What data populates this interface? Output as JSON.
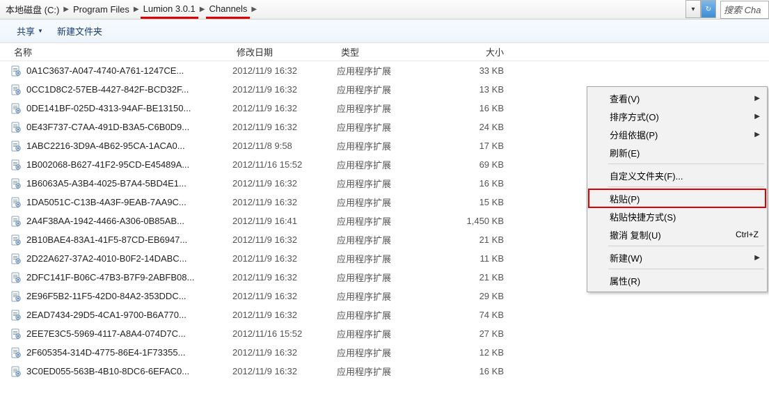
{
  "breadcrumb": {
    "items": [
      {
        "label": "本地磁盘 (C:)",
        "underline": false
      },
      {
        "label": "Program Files",
        "underline": false
      },
      {
        "label": "Lumion 3.0.1",
        "underline": true
      },
      {
        "label": "Channels",
        "underline": true
      }
    ]
  },
  "search": {
    "placeholder": "搜索 Cha"
  },
  "toolbar": {
    "share": "共享",
    "newfolder": "新建文件夹"
  },
  "columns": {
    "name": "名称",
    "date": "修改日期",
    "type": "类型",
    "size": "大小"
  },
  "file_type_label": "应用程序扩展",
  "files": [
    {
      "name": "0A1C3637-A047-4740-A761-1247CE...",
      "date": "2012/11/9 16:32",
      "size": "33 KB"
    },
    {
      "name": "0CC1D8C2-57EB-4427-842F-BCD32F...",
      "date": "2012/11/9 16:32",
      "size": "13 KB"
    },
    {
      "name": "0DE141BF-025D-4313-94AF-BE13150...",
      "date": "2012/11/9 16:32",
      "size": "16 KB"
    },
    {
      "name": "0E43F737-C7AA-491D-B3A5-C6B0D9...",
      "date": "2012/11/9 16:32",
      "size": "24 KB"
    },
    {
      "name": "1ABC2216-3D9A-4B62-95CA-1ACA0...",
      "date": "2012/11/8 9:58",
      "size": "17 KB"
    },
    {
      "name": "1B002068-B627-41F2-95CD-E45489A...",
      "date": "2012/11/16 15:52",
      "size": "69 KB"
    },
    {
      "name": "1B6063A5-A3B4-4025-B7A4-5BD4E1...",
      "date": "2012/11/9 16:32",
      "size": "16 KB"
    },
    {
      "name": "1DA5051C-C13B-4A3F-9EAB-7AA9C...",
      "date": "2012/11/9 16:32",
      "size": "15 KB"
    },
    {
      "name": "2A4F38AA-1942-4466-A306-0B85AB...",
      "date": "2012/11/9 16:41",
      "size": "1,450 KB"
    },
    {
      "name": "2B10BAE4-83A1-41F5-87CD-EB6947...",
      "date": "2012/11/9 16:32",
      "size": "21 KB"
    },
    {
      "name": "2D22A627-37A2-4010-B0F2-14DABC...",
      "date": "2012/11/9 16:32",
      "size": "11 KB"
    },
    {
      "name": "2DFC141F-B06C-47B3-B7F9-2ABFB08...",
      "date": "2012/11/9 16:32",
      "size": "21 KB"
    },
    {
      "name": "2E96F5B2-11F5-42D0-84A2-353DDC...",
      "date": "2012/11/9 16:32",
      "size": "29 KB"
    },
    {
      "name": "2EAD7434-29D5-4CA1-9700-B6A770...",
      "date": "2012/11/9 16:32",
      "size": "74 KB"
    },
    {
      "name": "2EE7E3C5-5969-4117-A8A4-074D7C...",
      "date": "2012/11/16 15:52",
      "size": "27 KB"
    },
    {
      "name": "2F605354-314D-4775-86E4-1F73355...",
      "date": "2012/11/9 16:32",
      "size": "12 KB"
    },
    {
      "name": "3C0ED055-563B-4B10-8DC6-6EFAC0...",
      "date": "2012/11/9 16:32",
      "size": "16 KB"
    }
  ],
  "context_menu": {
    "view": "查看(V)",
    "sort": "排序方式(O)",
    "group": "分组依据(P)",
    "refresh": "刷新(E)",
    "customize": "自定义文件夹(F)...",
    "paste": "粘贴(P)",
    "paste_shortcut": "粘贴快捷方式(S)",
    "undo_copy": "撤消 复制(U)",
    "undo_shortcut": "Ctrl+Z",
    "new": "新建(W)",
    "properties": "属性(R)"
  }
}
